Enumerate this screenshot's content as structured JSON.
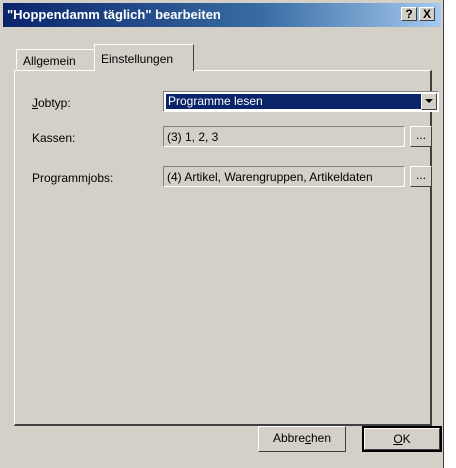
{
  "window": {
    "title": "\"Hoppendamm täglich\" bearbeiten",
    "help_button": "?",
    "close_button": "X"
  },
  "tabs": [
    {
      "label": "Allgemein",
      "active": false
    },
    {
      "label": "Einstellungen",
      "active": true
    }
  ],
  "form": {
    "jobtyp": {
      "label_prefix": "J",
      "label_rest": "obtyp:",
      "value": "Programme lesen"
    },
    "kassen": {
      "label": "Kassen:",
      "value": "(3) 1, 2, 3",
      "button": "..."
    },
    "programmjobs": {
      "label": "Programmjobs:",
      "value": "(4) Artikel, Warengruppen, Artikeldaten",
      "button": "..."
    }
  },
  "buttons": {
    "cancel_pre": "Abbre",
    "cancel_u": "c",
    "cancel_post": "hen",
    "ok_u": "O",
    "ok_post": "K"
  },
  "colors": {
    "face": "#d4d0c8",
    "title_start": "#0a246a",
    "selection": "#0a246a"
  }
}
